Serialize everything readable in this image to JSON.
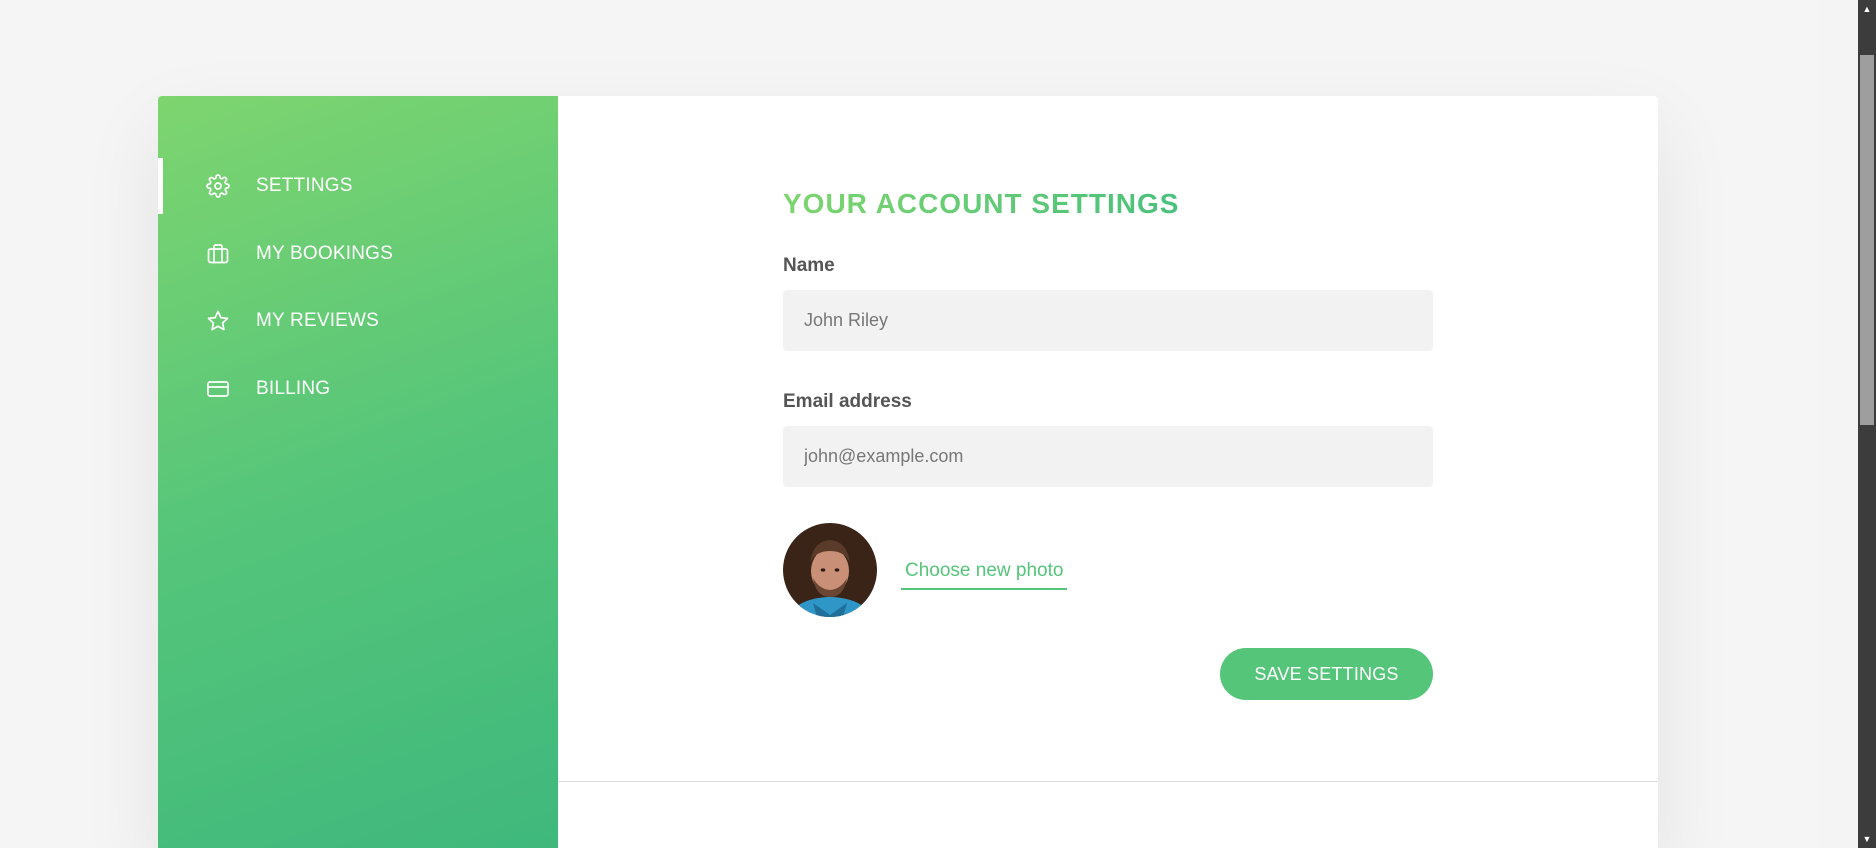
{
  "sidebar": {
    "items": [
      {
        "label": "SETTINGS",
        "icon": "gear-icon",
        "active": true
      },
      {
        "label": "MY BOOKINGS",
        "icon": "briefcase-icon",
        "active": false
      },
      {
        "label": "MY REVIEWS",
        "icon": "star-icon",
        "active": false
      },
      {
        "label": "BILLING",
        "icon": "credit-card-icon",
        "active": false
      }
    ]
  },
  "main": {
    "heading": "YOUR ACCOUNT SETTINGS",
    "name_label": "Name",
    "name_value": "John Riley",
    "email_label": "Email address",
    "email_value": "john@example.com",
    "photo_link": "Choose new photo",
    "save_button": "SAVE SETTINGS"
  },
  "colors": {
    "gradient_start": "#7ed56f",
    "gradient_end": "#28b485",
    "accent": "#55c57a",
    "input_bg": "#f2f2f2"
  },
  "scrollbar": {
    "up_icon": "arrow-up-icon",
    "down_icon": "arrow-down-icon"
  }
}
